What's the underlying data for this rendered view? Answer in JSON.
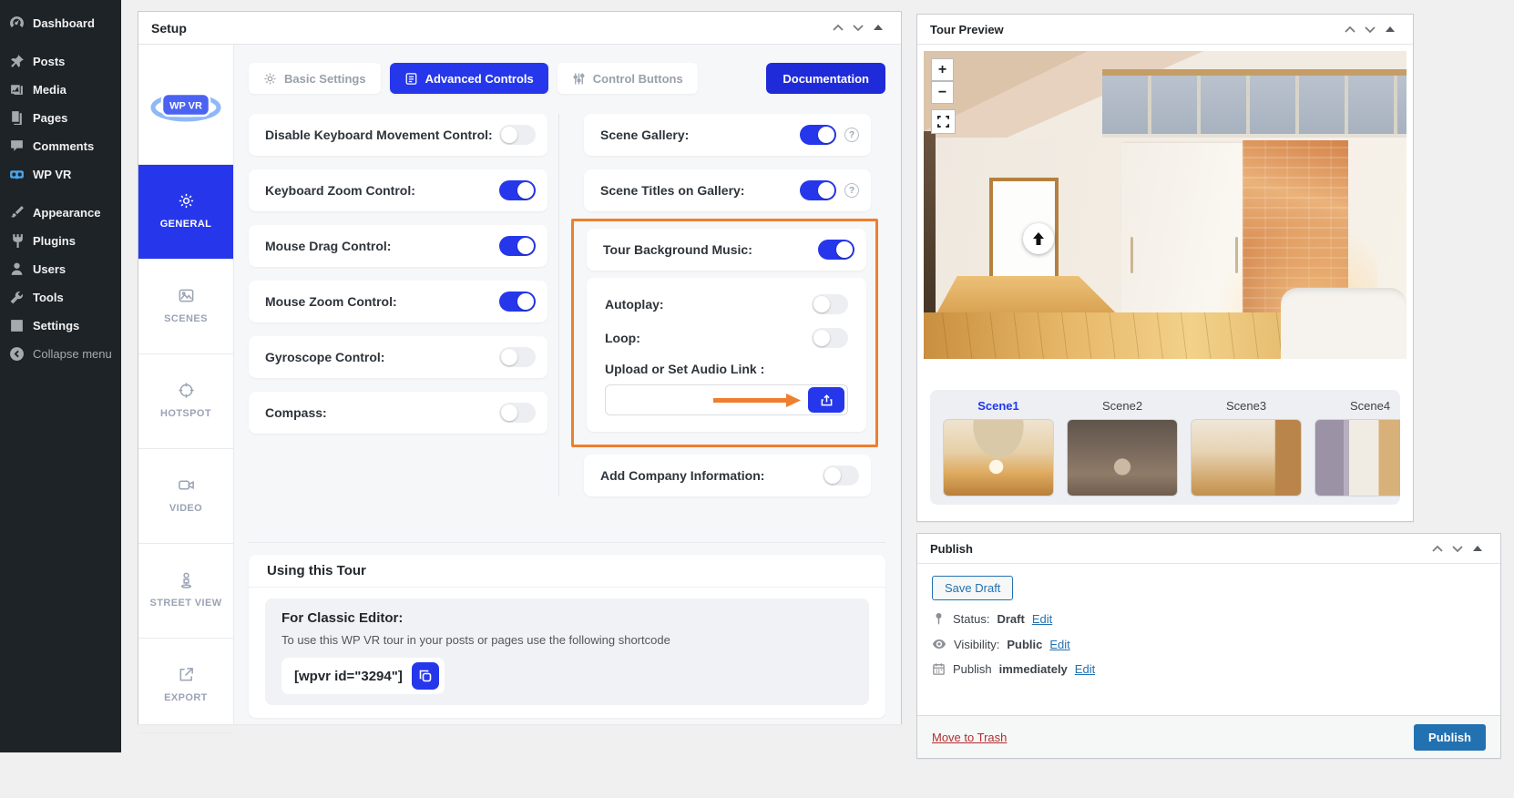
{
  "colors": {
    "accent": "#2637eb",
    "wp_blue": "#2271b1",
    "highlight_orange": "#ef7e2e",
    "trash_red": "#b32d2e"
  },
  "wp_sidebar": {
    "items": [
      {
        "label": "Dashboard",
        "icon": "dashboard-icon"
      },
      {
        "label": "Posts",
        "icon": "pushpin-icon"
      },
      {
        "label": "Media",
        "icon": "media-icon"
      },
      {
        "label": "Pages",
        "icon": "pages-icon"
      },
      {
        "label": "Comments",
        "icon": "comment-icon"
      },
      {
        "label": "WP VR",
        "icon": "vr-goggles-icon"
      },
      {
        "label": "Appearance",
        "icon": "brush-icon"
      },
      {
        "label": "Plugins",
        "icon": "plug-icon"
      },
      {
        "label": "Users",
        "icon": "user-icon"
      },
      {
        "label": "Tools",
        "icon": "wrench-icon"
      },
      {
        "label": "Settings",
        "icon": "settings-icon"
      }
    ],
    "collapse_label": "Collapse menu"
  },
  "setup": {
    "title": "Setup",
    "logo_text": "WP VR",
    "tabs": [
      {
        "label": "Basic Settings",
        "active": false
      },
      {
        "label": "Advanced Controls",
        "active": true
      },
      {
        "label": "Control Buttons",
        "active": false
      }
    ],
    "documentation_label": "Documentation",
    "side_tabs": [
      {
        "label": "GENERAL",
        "active": true
      },
      {
        "label": "SCENES",
        "active": false
      },
      {
        "label": "HOTSPOT",
        "active": false
      },
      {
        "label": "VIDEO",
        "active": false
      },
      {
        "label": "STREET VIEW",
        "active": false
      },
      {
        "label": "EXPORT",
        "active": false
      }
    ],
    "left_controls": [
      {
        "label": "Disable Keyboard Movement Control:",
        "on": false
      },
      {
        "label": "Keyboard Zoom Control:",
        "on": true
      },
      {
        "label": "Mouse Drag Control:",
        "on": true
      },
      {
        "label": "Mouse Zoom Control:",
        "on": true
      },
      {
        "label": "Gyroscope Control:",
        "on": false
      },
      {
        "label": "Compass:",
        "on": false
      }
    ],
    "right_controls": [
      {
        "label": "Scene Gallery:",
        "on": true,
        "help": "?"
      },
      {
        "label": "Scene Titles on Gallery:",
        "on": true,
        "help": "?"
      }
    ],
    "music": {
      "label": "Tour Background Music:",
      "on": true,
      "autoplay_label": "Autoplay:",
      "autoplay_on": false,
      "loop_label": "Loop:",
      "loop_on": false,
      "upload_label": "Upload or Set Audio Link :",
      "input_value": ""
    },
    "company": {
      "label": "Add Company Information:",
      "on": false
    },
    "using_tour": {
      "title": "Using this Tour",
      "editor_heading": "For Classic Editor:",
      "description": "To use this WP VR tour in your posts or pages use the following shortcode",
      "shortcode": "[wpvr id=\"3294\"]"
    }
  },
  "tour_preview": {
    "title": "Tour Preview",
    "zoom_in": "+",
    "zoom_out": "−",
    "scenes": [
      {
        "label": "Scene1",
        "active": true
      },
      {
        "label": "Scene2",
        "active": false
      },
      {
        "label": "Scene3",
        "active": false
      },
      {
        "label": "Scene4",
        "active": false
      }
    ]
  },
  "publish": {
    "title": "Publish",
    "save_draft": "Save Draft",
    "status_label": "Status:",
    "status_value": "Draft",
    "visibility_label": "Visibility:",
    "visibility_value": "Public",
    "schedule_label": "Publish",
    "schedule_value": "immediately",
    "edit": "Edit",
    "move_to_trash": "Move to Trash",
    "publish_button": "Publish"
  }
}
